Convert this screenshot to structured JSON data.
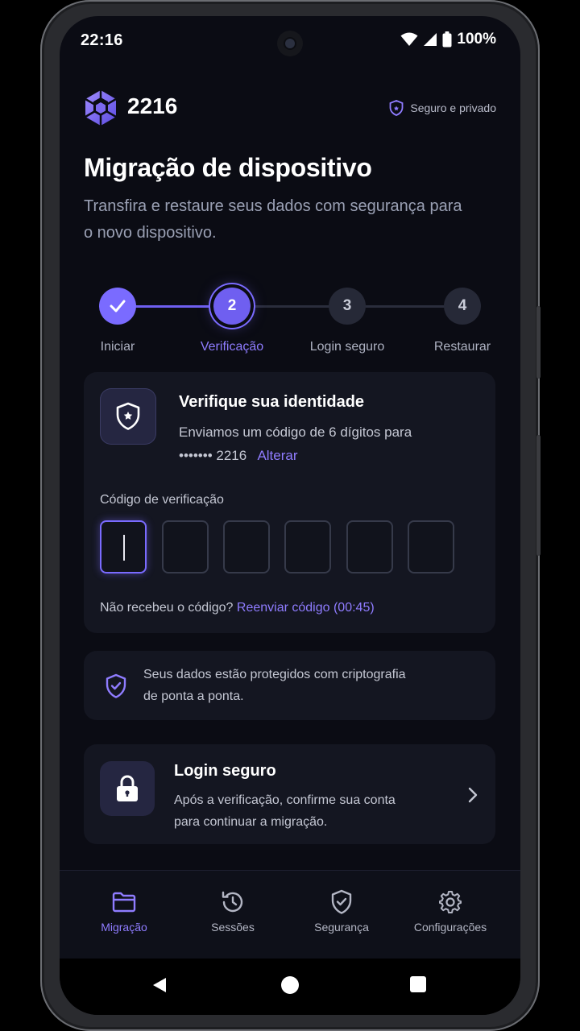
{
  "status_bar": {
    "time": "22:16",
    "battery": "100%"
  },
  "header": {
    "brand": "2216",
    "secure_label": "Seguro e privado"
  },
  "page": {
    "title": "Migração de dispositivo",
    "subtitle": "Transfira e restaure seus dados com segurança para o novo dispositivo."
  },
  "stepper": {
    "steps": [
      {
        "number": "✓",
        "label": "Iniciar",
        "state": "done"
      },
      {
        "number": "2",
        "label": "Verificação",
        "state": "current"
      },
      {
        "number": "3",
        "label": "Login seguro",
        "state": "pending"
      },
      {
        "number": "4",
        "label": "Restaurar",
        "state": "pending"
      }
    ]
  },
  "verify_card": {
    "title": "Verifique sua identidade",
    "line1": "Enviamos um código de 6 dígitos para",
    "masked_phone": "••••••• 2216",
    "change_link": "Alterar",
    "code_label": "Código de verificação",
    "code_digits": [
      "",
      "",
      "",
      "",
      "",
      ""
    ],
    "resend_prompt": "Não recebeu o código?",
    "resend_link": "Reenviar código (00:45)"
  },
  "encryption_notice": {
    "text_line1": "Seus dados estão protegidos com criptografia",
    "text_line2": "de ponta a ponta."
  },
  "login_card": {
    "title": "Login seguro",
    "text_line1": "Após a verificação, confirme sua conta",
    "text_line2": "para continuar a migração."
  },
  "bottom_nav": {
    "items": [
      {
        "label": "Migração",
        "icon": "folder-icon",
        "active": true
      },
      {
        "label": "Sessões",
        "icon": "history-icon",
        "active": false
      },
      {
        "label": "Segurança",
        "icon": "shield-check-icon",
        "active": false
      },
      {
        "label": "Configurações",
        "icon": "gear-icon",
        "active": false
      }
    ]
  },
  "colors": {
    "accent": "#7a6bff",
    "background": "#0b0c14",
    "card": "#141621"
  }
}
